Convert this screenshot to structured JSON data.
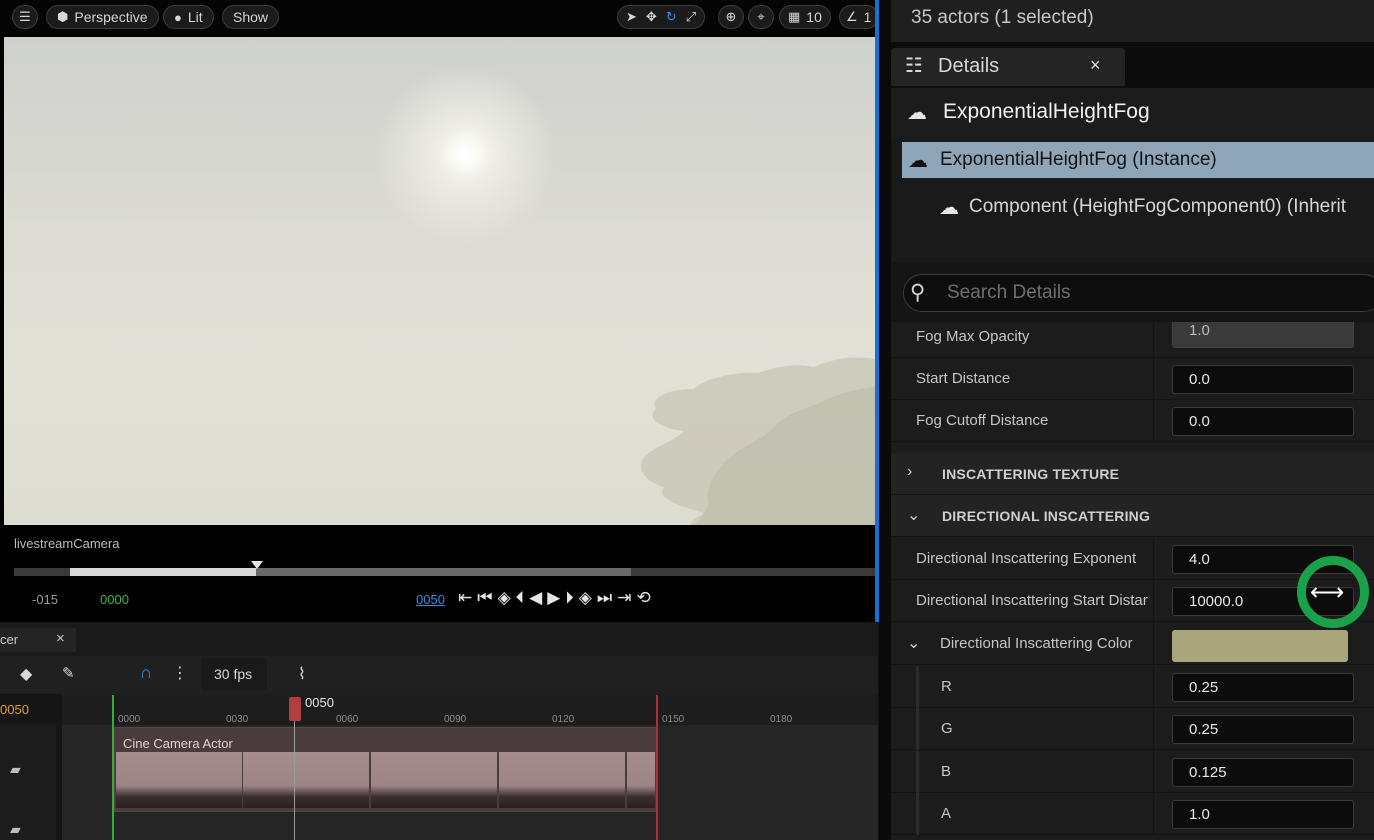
{
  "viewport": {
    "toolbar": {
      "menu_icon": "hamburger-icon",
      "perspective_label": "Perspective",
      "lit_label": "Lit",
      "show_label": "Show",
      "grid_value": "10",
      "angle_value": "1"
    },
    "camera_label": "livestreamCamera",
    "timecode_start": "-015",
    "timecode_current": "0000",
    "timecode_playhead": "0050"
  },
  "sequencer": {
    "tab_label": "cer",
    "tab_close": "×",
    "fps_label": "30 fps",
    "current_frame": "0050",
    "playhead_label": "0050",
    "ruler_ticks": [
      "0000",
      "0030",
      "0060",
      "0090",
      "0120",
      "0150",
      "0180"
    ],
    "clip_label": "Cine Camera Actor"
  },
  "details": {
    "actors_status": "35 actors (1 selected)",
    "tab_title": "Details",
    "tab_close": "×",
    "object_name": "ExponentialHeightFog",
    "tree": [
      {
        "label": "ExponentialHeightFog (Instance)",
        "selected": true
      },
      {
        "label": "Component (HeightFogComponent0) (Inherit",
        "selected": false
      }
    ],
    "search_placeholder": "Search Details",
    "properties_top": [
      {
        "label": "Fog Max Opacity",
        "value": "1.0"
      },
      {
        "label": "Start Distance",
        "value": "0.0"
      },
      {
        "label": "Fog Cutoff Distance",
        "value": "0.0"
      }
    ],
    "section_inscattering_texture": "INSCATTERING TEXTURE",
    "section_directional": "DIRECTIONAL INSCATTERING",
    "directional_props": [
      {
        "label": "Directional Inscattering Exponent",
        "value": "4.0"
      },
      {
        "label": "Directional Inscattering Start Distar",
        "value": "10000.0"
      }
    ],
    "color_label": "Directional Inscattering Color",
    "color_value": "#a8a77c",
    "color_channels": [
      {
        "label": "R",
        "value": "0.25"
      },
      {
        "label": "G",
        "value": "0.25"
      },
      {
        "label": "B",
        "value": "0.125"
      },
      {
        "label": "A",
        "value": "1.0"
      }
    ]
  },
  "colors": {
    "accent_blue": "#1a6fd4",
    "selection": "#8fa6b8",
    "cursor_ring": "#1aa24a"
  }
}
